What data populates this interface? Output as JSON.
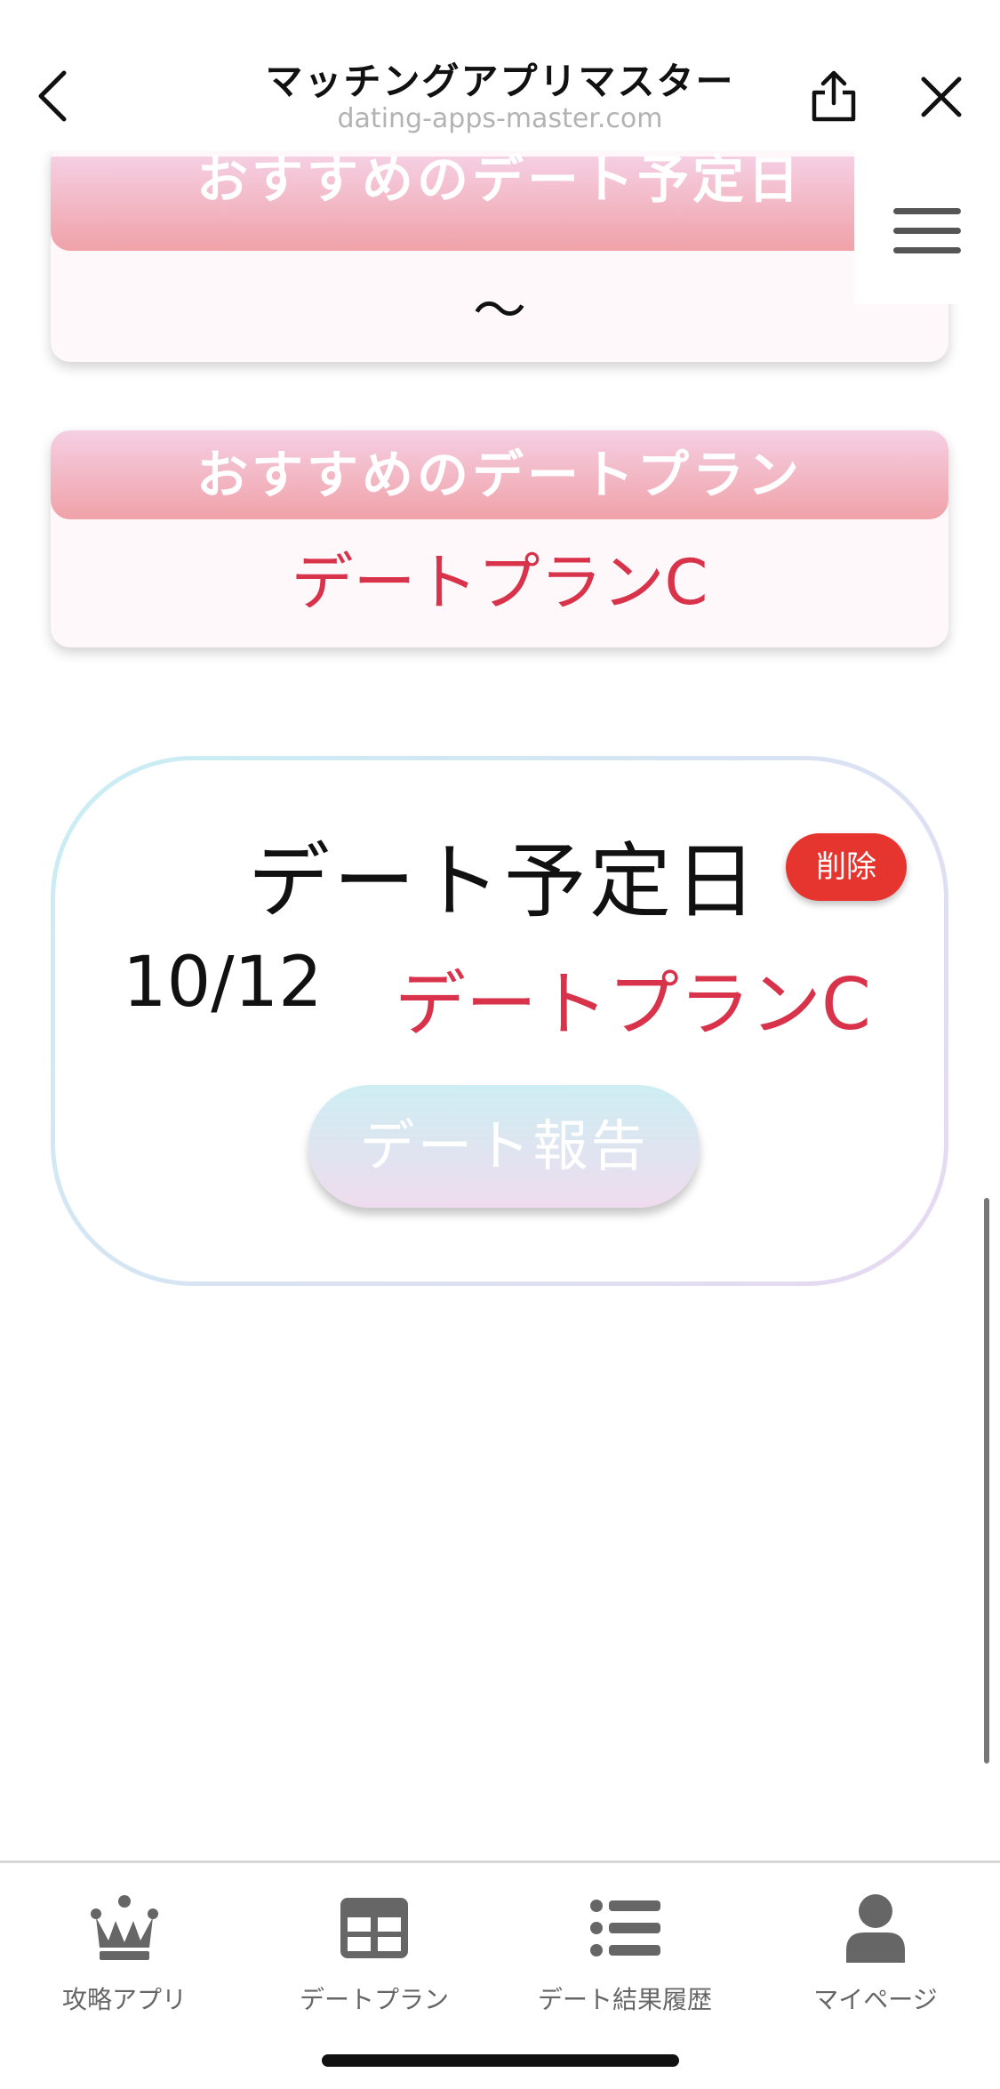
{
  "header": {
    "title": "マッチングアプリマスター",
    "url": "dating-apps-master.com"
  },
  "cards": [
    {
      "heading": "おすすめのデート予定日",
      "value": "〜"
    },
    {
      "heading": "おすすめのデートプラン",
      "value": "デートプランC"
    }
  ],
  "schedule": {
    "title": "デート予定日",
    "delete_label": "削除",
    "date": "10/12",
    "plan": "デートプランC",
    "report_label": "デート報告"
  },
  "tabs": [
    {
      "label": "攻略アプリ",
      "icon": "crown-icon"
    },
    {
      "label": "デートプラン",
      "icon": "grid-icon"
    },
    {
      "label": "デート結果履歴",
      "icon": "list-icon"
    },
    {
      "label": "マイページ",
      "icon": "person-icon"
    }
  ],
  "colors": {
    "accent_red": "#d8334a",
    "delete_red": "#e6342e",
    "card_header_from": "#f5cfe3",
    "card_header_to": "#f0a2a8"
  }
}
